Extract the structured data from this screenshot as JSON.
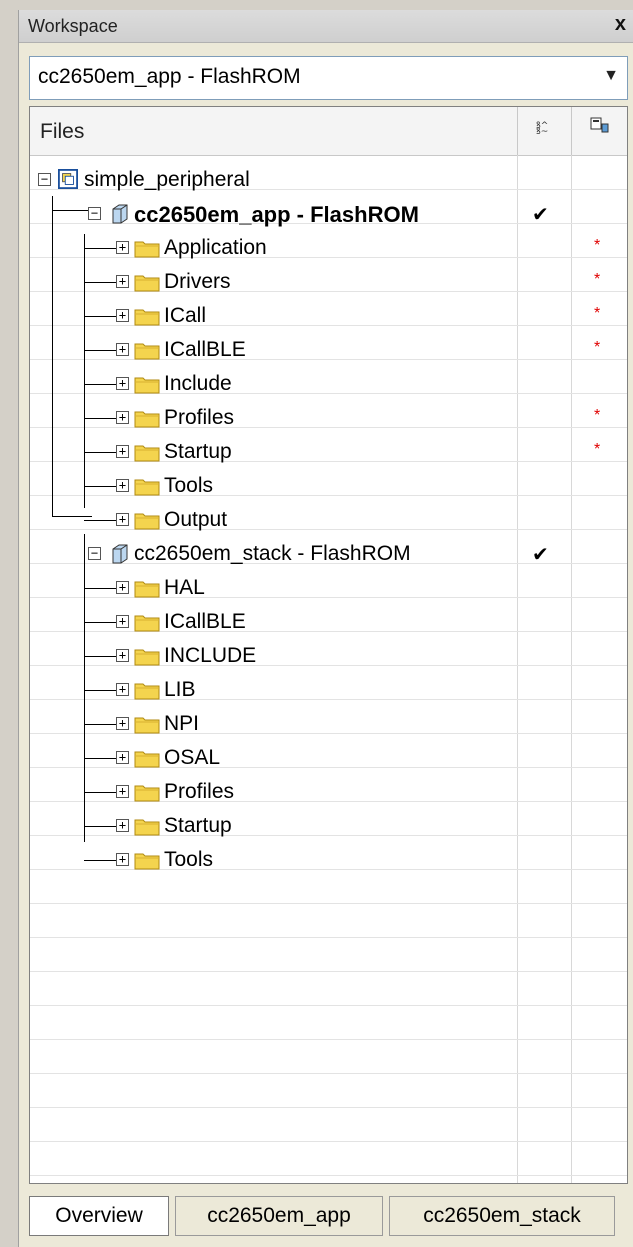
{
  "window": {
    "title": "Workspace",
    "close_label": "x"
  },
  "config_select": {
    "value": "cc2650em_app - FlashROM"
  },
  "files_header": {
    "label": "Files"
  },
  "tree": {
    "root": {
      "label": "simple_peripheral"
    },
    "project_app": {
      "label": "cc2650em_app - FlashROM",
      "check": "✔"
    },
    "app_folders": [
      {
        "label": "Application",
        "star": "*"
      },
      {
        "label": "Drivers",
        "star": "*"
      },
      {
        "label": "ICall",
        "star": "*"
      },
      {
        "label": "ICallBLE",
        "star": "*"
      },
      {
        "label": "Include",
        "star": ""
      },
      {
        "label": "Profiles",
        "star": "*"
      },
      {
        "label": "Startup",
        "star": "*"
      },
      {
        "label": "Tools",
        "star": ""
      },
      {
        "label": "Output",
        "star": ""
      }
    ],
    "project_stack": {
      "label": "cc2650em_stack - FlashROM",
      "check": "✔"
    },
    "stack_folders": [
      {
        "label": "HAL"
      },
      {
        "label": "ICallBLE"
      },
      {
        "label": "INCLUDE"
      },
      {
        "label": "LIB"
      },
      {
        "label": "NPI"
      },
      {
        "label": "OSAL"
      },
      {
        "label": "Profiles"
      },
      {
        "label": "Startup"
      },
      {
        "label": "Tools"
      }
    ]
  },
  "tabs": [
    {
      "label": "Overview"
    },
    {
      "label": "cc2650em_app"
    },
    {
      "label": "cc2650em_stack"
    }
  ],
  "colors": {
    "folder": "#f4d44e",
    "star": "#e00000",
    "cube": "#5b9bd5"
  }
}
